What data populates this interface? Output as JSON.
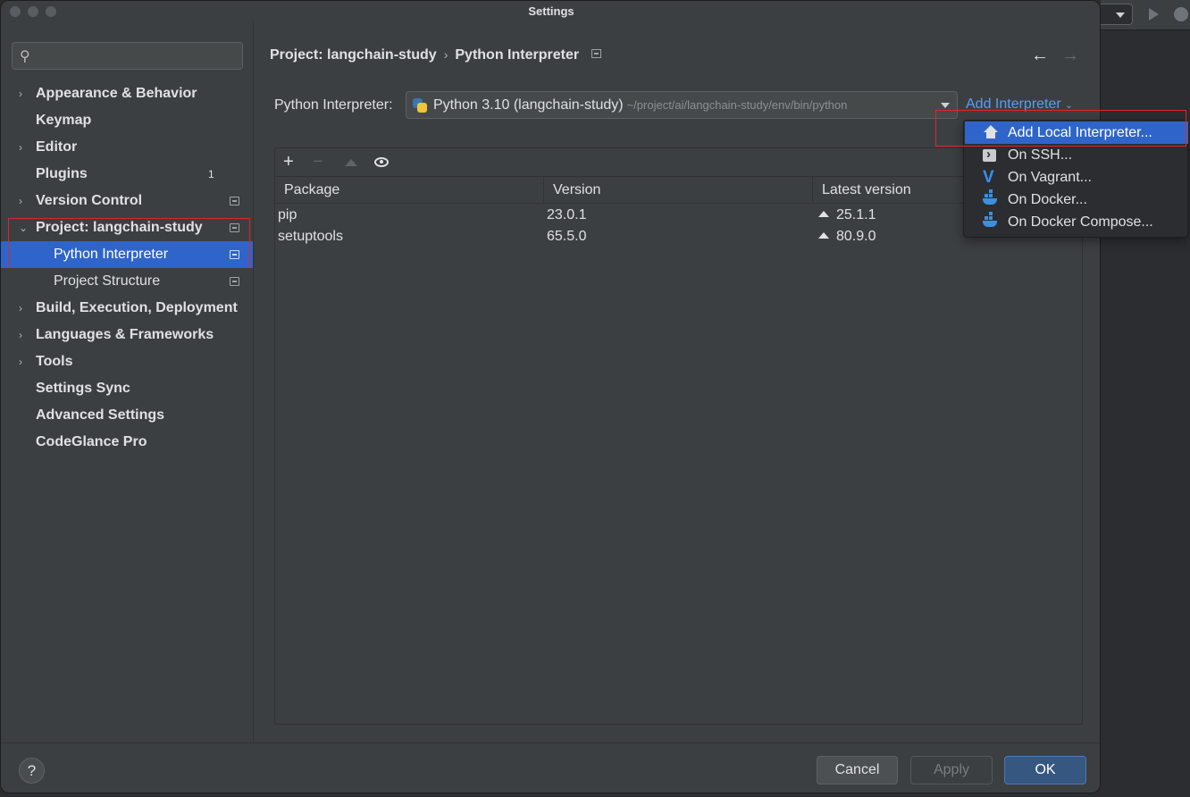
{
  "window": {
    "title": "Settings"
  },
  "search": {
    "placeholder": "",
    "value": ""
  },
  "sidebar": {
    "items": [
      {
        "label": "Appearance & Behavior",
        "arrow": "›"
      },
      {
        "label": "Keymap",
        "arrow": ""
      },
      {
        "label": "Editor",
        "arrow": "›"
      },
      {
        "label": "Plugins",
        "arrow": "",
        "badge": "1"
      },
      {
        "label": "Version Control",
        "arrow": "›"
      },
      {
        "label": "Project: langchain-study",
        "arrow": "⌄"
      },
      {
        "label": "Python Interpreter",
        "arrow": ""
      },
      {
        "label": "Project Structure",
        "arrow": ""
      },
      {
        "label": "Build, Execution, Deployment",
        "arrow": "›"
      },
      {
        "label": "Languages & Frameworks",
        "arrow": "›"
      },
      {
        "label": "Tools",
        "arrow": "›"
      },
      {
        "label": "Settings Sync",
        "arrow": ""
      },
      {
        "label": "Advanced Settings",
        "arrow": ""
      },
      {
        "label": "CodeGlance Pro",
        "arrow": ""
      }
    ]
  },
  "breadcrumb": {
    "parent": "Project: langchain-study",
    "separator": "›",
    "current": "Python Interpreter"
  },
  "nav": {
    "back": "←",
    "forward": "→"
  },
  "interpreter": {
    "label": "Python Interpreter:",
    "name": "Python 3.10 (langchain-study)",
    "path": "~/project/ai/langchain-study/env/bin/python",
    "add_label": "Add Interpreter",
    "add_chevron": "⌄"
  },
  "toolbar": {
    "add": "+",
    "remove": "−"
  },
  "packages": {
    "columns": [
      "Package",
      "Version",
      "Latest version"
    ],
    "rows": [
      {
        "name": "pip",
        "version": "23.0.1",
        "latest": "25.1.1"
      },
      {
        "name": "setuptools",
        "version": "65.5.0",
        "latest": "80.9.0"
      }
    ]
  },
  "menu": {
    "items": [
      {
        "label": "Add Local Interpreter...",
        "icon": "home-icon"
      },
      {
        "label": "On SSH...",
        "icon": "terminal-icon"
      },
      {
        "label": "On Vagrant...",
        "icon": "vagrant-icon"
      },
      {
        "label": "On Docker...",
        "icon": "docker-icon"
      },
      {
        "label": "On Docker Compose...",
        "icon": "docker-icon"
      }
    ],
    "vagrant_glyph": "V"
  },
  "footer": {
    "help": "?",
    "cancel": "Cancel",
    "apply": "Apply",
    "ok": "OK"
  },
  "colors": {
    "accent": "#2f65ca",
    "link": "#589df6",
    "highlight_box": "#e0252a",
    "ok_button": "#365880"
  }
}
